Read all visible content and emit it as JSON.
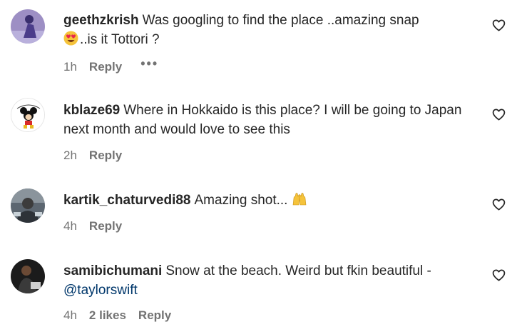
{
  "comments": [
    {
      "username": "geethzkrish",
      "text_a": "Was googling to find the place ..amazing snap",
      "text_b": "..is it Tottori ?",
      "emoji": "heart-eyes-emoji",
      "time": "1h",
      "reply": "Reply",
      "more": "•••"
    },
    {
      "username": "kblaze69",
      "text": "Where in Hokkaido is this place? I will be going to Japan next month and would love to see this",
      "time": "2h",
      "reply": "Reply"
    },
    {
      "username": "kartik_chaturvedi88",
      "text": "Amazing shot...",
      "emoji": "raising-hands-emoji",
      "time": "4h",
      "reply": "Reply"
    },
    {
      "username": "samibichumani",
      "text": "Snow at the beach. Weird but fkin beautiful -",
      "mention": "@taylorswift",
      "time": "4h",
      "likes": "2 likes",
      "reply": "Reply"
    }
  ],
  "icons": {
    "like": "heart-outline-icon"
  },
  "colors": {
    "text": "#262626",
    "secondary": "#737373",
    "mention": "#00376b"
  }
}
